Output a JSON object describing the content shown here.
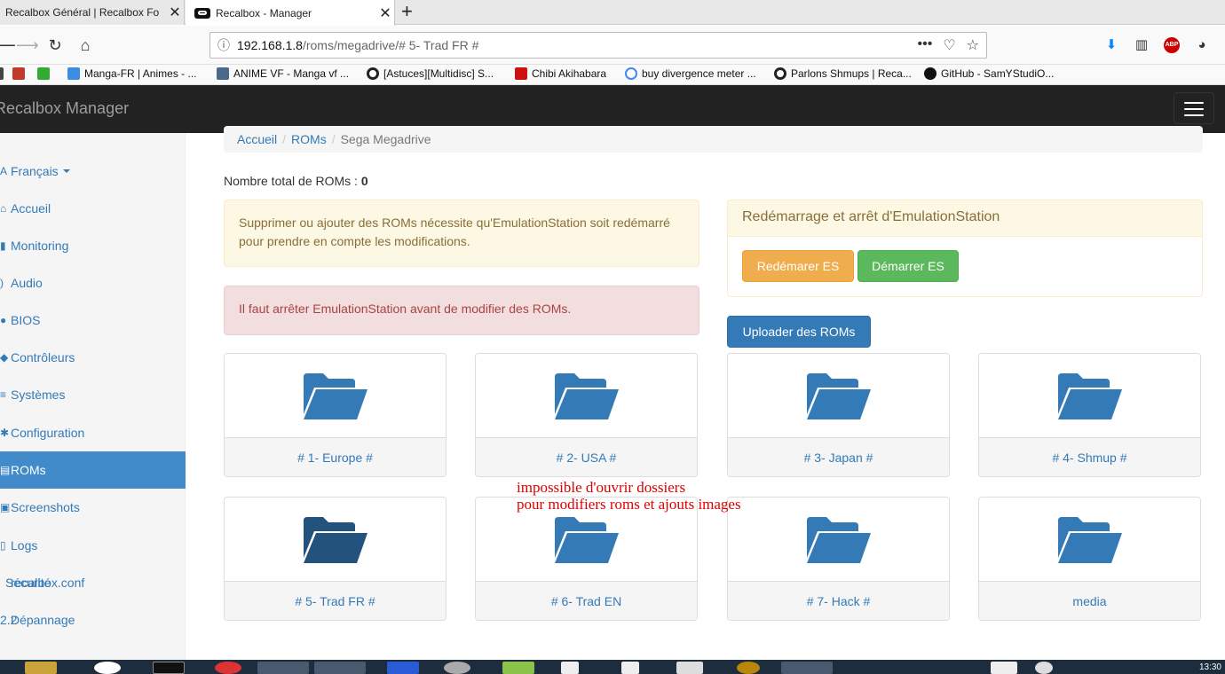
{
  "browser": {
    "tabs": [
      {
        "title": "Recalbox Général | Recalbox Fo",
        "active": false
      },
      {
        "title": "Recalbox - Manager",
        "active": true
      }
    ],
    "url": {
      "host": "192.168.1.8",
      "path": "/roms/megadrive/# 5- Trad FR #"
    },
    "bookmarks": [
      {
        "label": "Manga-FR | Animes - ...",
        "color": "#3a8de0"
      },
      {
        "label": "ANIME VF - Manga vf ...",
        "color": "#4b6a8a"
      },
      {
        "label": "[Astuces][Multidisc] S...",
        "color": "#222222"
      },
      {
        "label": "Chibi Akihabara",
        "color": "#cc1111"
      },
      {
        "label": "buy divergence meter ...",
        "color": "#4285f4"
      },
      {
        "label": "Parlons Shmups | Reca...",
        "color": "#222222"
      },
      {
        "label": "GitHub - SamYStudiO...",
        "color": "#111111"
      }
    ]
  },
  "app": {
    "brand": "Recalbox Manager",
    "sidebar": [
      {
        "label": "Français",
        "icon": "language-icon",
        "glyph": "A",
        "dropdown": true
      },
      {
        "label": "Accueil",
        "icon": "home-icon",
        "glyph": "⌂"
      },
      {
        "label": "Monitoring",
        "icon": "chart-icon",
        "glyph": "▮"
      },
      {
        "label": "Audio",
        "icon": "speaker-icon",
        "glyph": "◂"
      },
      {
        "label": "BIOS",
        "icon": "chip-icon",
        "glyph": "●"
      },
      {
        "label": "Contrôleurs",
        "icon": "gamepad-icon",
        "glyph": "◆"
      },
      {
        "label": "Systèmes",
        "icon": "list-icon",
        "glyph": "≡"
      },
      {
        "label": "Configuration",
        "icon": "gear-icon",
        "glyph": "✱"
      },
      {
        "label": "ROMs",
        "icon": "file-icon",
        "glyph": "▤",
        "active": true
      },
      {
        "label": "Screenshots",
        "icon": "picture-icon",
        "glyph": "▣"
      },
      {
        "label": "Logs",
        "icon": "document-icon",
        "glyph": "▯"
      }
    ],
    "sidebar_overlaps": [
      {
        "a": "Sécurité",
        "b": "recalbox.conf"
      },
      {
        "a": "2.2",
        "b": "Dépannage"
      }
    ],
    "breadcrumb": {
      "home": "Accueil",
      "roms": "ROMs",
      "current": "Sega Megadrive"
    },
    "total": {
      "label": "Nombre total de ROMs :",
      "value": "0"
    },
    "alerts": {
      "warning": "Supprimer ou ajouter des ROMs nécessite qu'EmulationStation soit redémarré pour prendre en compte les modifications.",
      "danger": "Il faut arrêter EmulationStation avant de modifier des ROMs."
    },
    "panel": {
      "title": "Redémarrage et arrêt d'EmulationStation",
      "restart": "Redémarer ES",
      "start": "Démarrer ES"
    },
    "upload": "Uploader des ROMs",
    "folders": [
      {
        "name": "# 1- Europe #"
      },
      {
        "name": "# 2- USA #"
      },
      {
        "name": "# 3- Japan #"
      },
      {
        "name": "# 4- Shmup #"
      },
      {
        "name": "# 5- Trad FR #",
        "hover": true
      },
      {
        "name": "# 6- Trad EN"
      },
      {
        "name": "# 7- Hack #"
      },
      {
        "name": "media"
      }
    ],
    "annotation": [
      "impossible d'ouvrir dossiers",
      "pour modifiers roms et ajouts images"
    ]
  },
  "taskbar": {
    "clock": "13:30"
  },
  "colors": {
    "folder": "#337ab7",
    "folder_hover": "#23527c",
    "active_nav": "#428bca"
  }
}
